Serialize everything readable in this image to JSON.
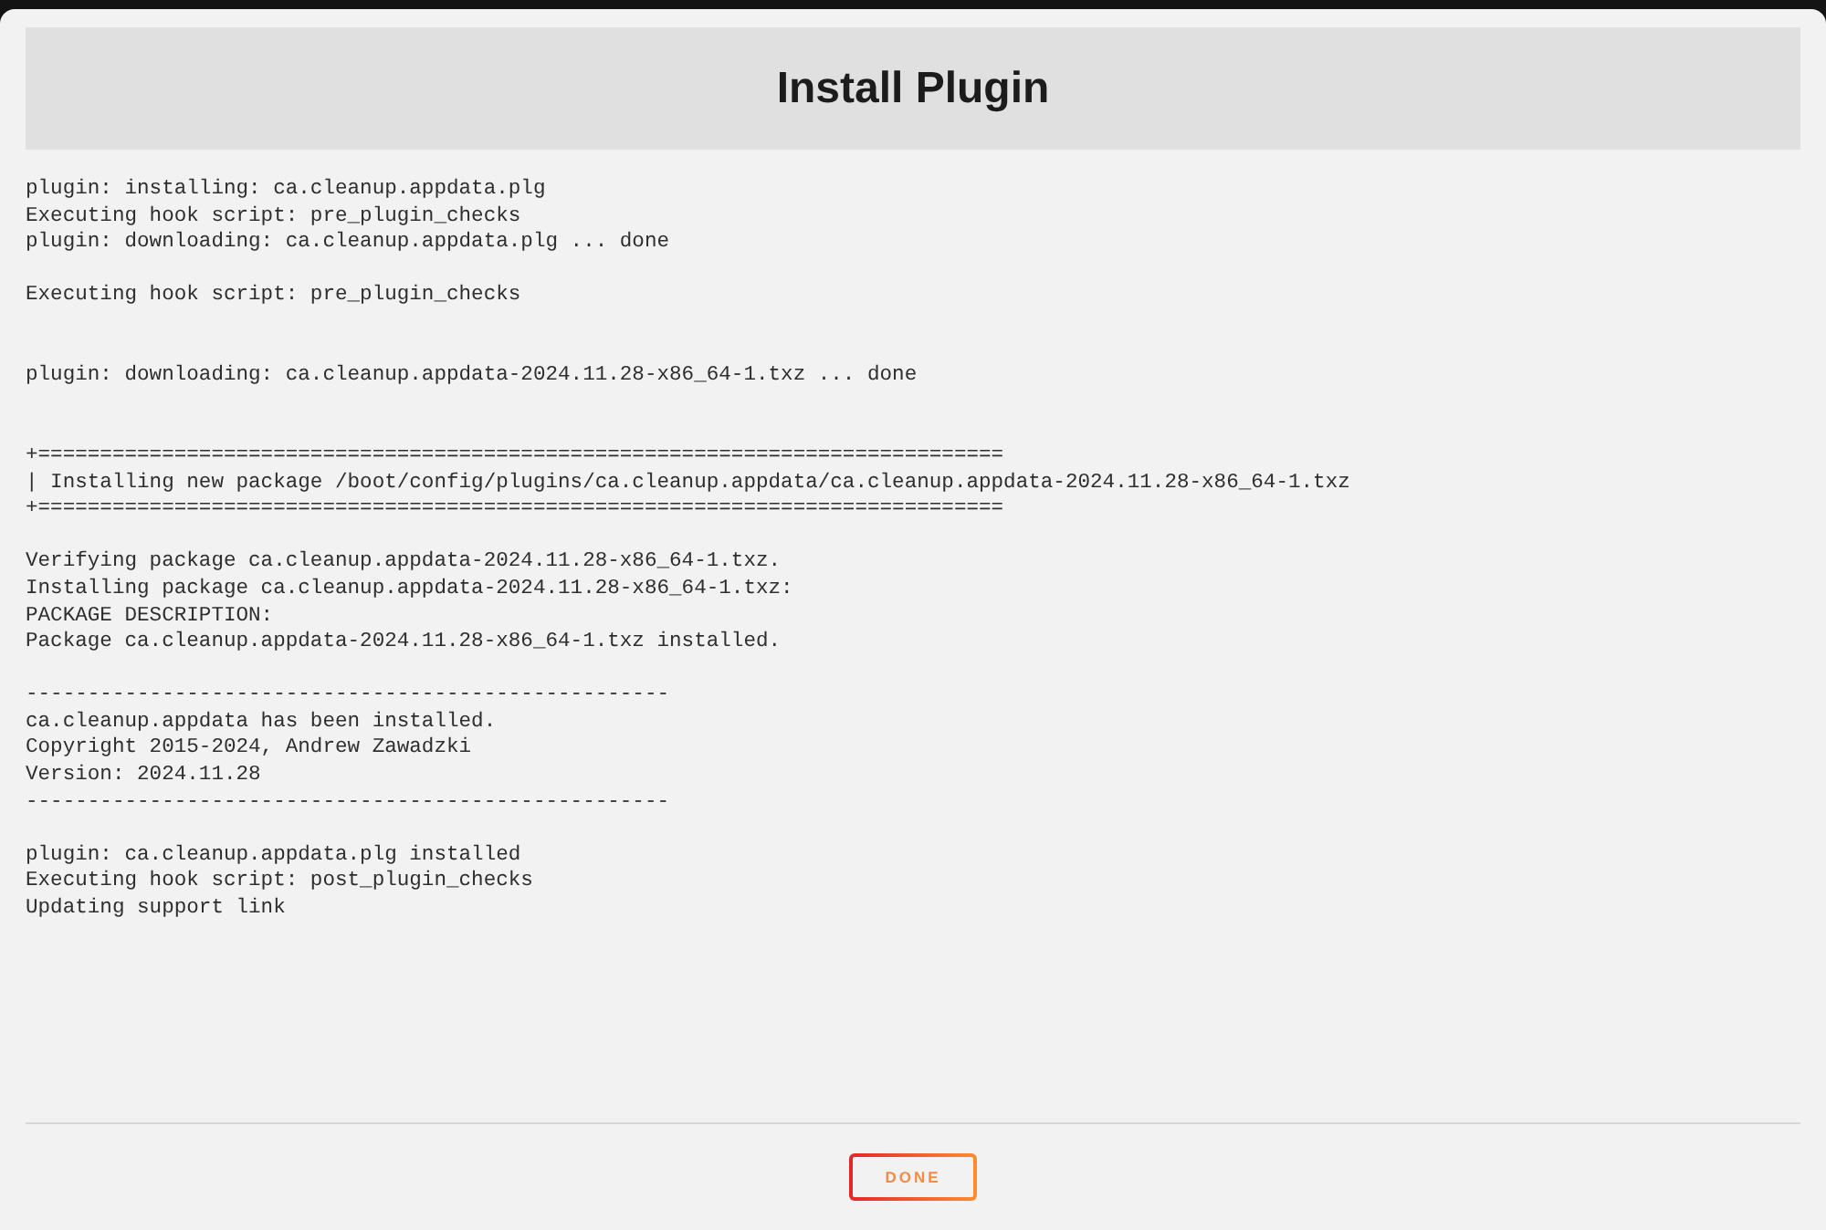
{
  "dialog": {
    "title": "Install Plugin"
  },
  "log": [
    {
      "lines": [
        "plugin: installing: ca.cleanup.appdata.plg",
        "Executing hook script: pre_plugin_checks",
        "plugin: downloading: ca.cleanup.appdata.plg ... done"
      ],
      "kind": "gap"
    },
    {
      "lines": [
        "Executing hook script: pre_plugin_checks"
      ],
      "kind": "wide_gap"
    },
    {
      "lines": [
        "plugin: downloading: ca.cleanup.appdata-2024.11.28-x86_64-1.txz ... done"
      ],
      "kind": "wide_gap"
    },
    {
      "lines": [
        "+==============================================================================",
        "| Installing new package /boot/config/plugins/ca.cleanup.appdata/ca.cleanup.appdata-2024.11.28-x86_64-1.txz",
        "+=============================================================================="
      ],
      "kind": "gap"
    },
    {
      "lines": [
        "Verifying package ca.cleanup.appdata-2024.11.28-x86_64-1.txz.",
        "Installing package ca.cleanup.appdata-2024.11.28-x86_64-1.txz:",
        "PACKAGE DESCRIPTION:",
        "Package ca.cleanup.appdata-2024.11.28-x86_64-1.txz installed."
      ],
      "kind": "gap"
    },
    {
      "lines": [
        "----------------------------------------------------",
        "ca.cleanup.appdata has been installed.",
        "Copyright 2015-2024, Andrew Zawadzki",
        "Version: 2024.11.28",
        "----------------------------------------------------"
      ],
      "kind": "gap"
    },
    {
      "lines": [
        "plugin: ca.cleanup.appdata.plg installed",
        "Executing hook script: post_plugin_checks",
        "Updating support link"
      ],
      "kind": "end"
    }
  ],
  "buttons": [
    {
      "label": "DONE",
      "kind": "outline"
    }
  ]
}
